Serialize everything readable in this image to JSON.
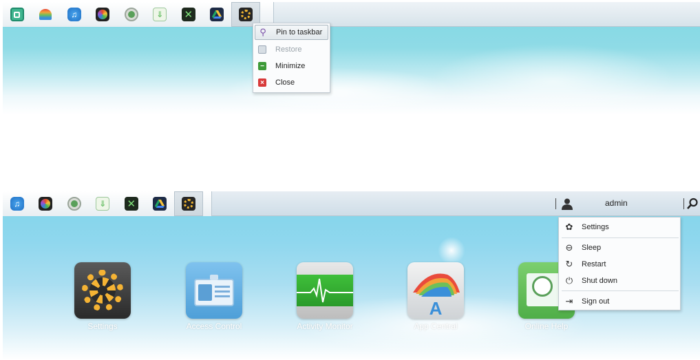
{
  "top_panel": {
    "taskbar_icons": [
      {
        "icon": "app-central-storage-icon",
        "color": "#3fb58f"
      },
      {
        "icon": "rainbow-app-icon",
        "color": "#2b6fa8"
      },
      {
        "icon": "itunes-music-icon",
        "color": "#1f6fc4"
      },
      {
        "icon": "color-ring-icon",
        "color": "#e44b2a"
      },
      {
        "icon": "green-circle-icon",
        "color": "#5aa05a"
      },
      {
        "icon": "download-disc-icon",
        "color": "#6cc06a"
      },
      {
        "icon": "xamarin-x-icon",
        "color": "#1e2a1e"
      },
      {
        "icon": "google-drive-icon",
        "color": "#1d2b46"
      },
      {
        "icon": "settings-gear-icon",
        "color": "#f0b531"
      }
    ],
    "context_menu": {
      "items": [
        {
          "label": "Pin to taskbar",
          "icon": "pin-icon",
          "color": "#7b4fa8",
          "highlighted": true,
          "disabled": false
        },
        {
          "label": "Restore",
          "icon": "restore-icon",
          "color": "#9aa7b5",
          "highlighted": false,
          "disabled": true
        },
        {
          "label": "Minimize",
          "icon": "minimize-icon",
          "color": "#3e9a38",
          "highlighted": false,
          "disabled": false
        },
        {
          "label": "Close",
          "icon": "close-icon",
          "color": "#d83a3a",
          "highlighted": false,
          "disabled": false
        }
      ]
    }
  },
  "bottom_panel": {
    "taskbar_icons": [
      {
        "icon": "itunes-music-icon",
        "color": "#1f6fc4"
      },
      {
        "icon": "color-ring-icon",
        "color": "#e44b2a"
      },
      {
        "icon": "green-circle-icon",
        "color": "#5aa05a"
      },
      {
        "icon": "download-disc-icon",
        "color": "#6cc06a"
      },
      {
        "icon": "xamarin-x-icon",
        "color": "#1e2a1e"
      },
      {
        "icon": "google-drive-icon",
        "color": "#1d2b46"
      },
      {
        "icon": "settings-gear-icon",
        "color": "#f0b531"
      }
    ],
    "user": {
      "name": "admin"
    },
    "user_menu": {
      "items": [
        {
          "label": "Settings",
          "icon": "gear-icon",
          "glyph": "✿"
        },
        {
          "label": "Sleep",
          "icon": "sleep-icon",
          "glyph": "⊖"
        },
        {
          "label": "Restart",
          "icon": "restart-icon",
          "glyph": "↻"
        },
        {
          "label": "Shut down",
          "icon": "power-icon",
          "glyph": "⏻"
        },
        {
          "label": "Sign out",
          "icon": "sign-out-icon",
          "glyph": "⇥"
        }
      ]
    },
    "apps": [
      {
        "label": "Settings",
        "icon": "settings-app-icon"
      },
      {
        "label": "Access Control",
        "icon": "access-control-app-icon"
      },
      {
        "label": "Activity Monitor",
        "icon": "activity-monitor-app-icon"
      },
      {
        "label": "App Central",
        "icon": "app-central-app-icon"
      },
      {
        "label": "Online Help",
        "icon": "online-help-app-icon"
      }
    ]
  }
}
